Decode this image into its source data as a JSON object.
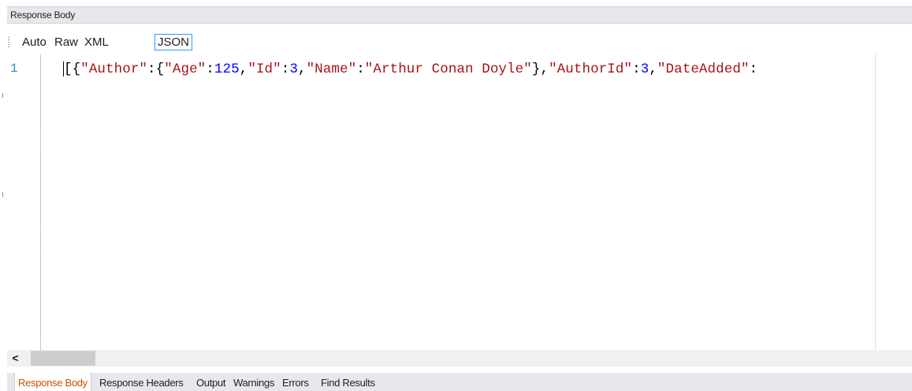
{
  "window": {
    "title": "Response Body"
  },
  "toolbar": {
    "buttons": [
      {
        "label": "Auto",
        "active": false
      },
      {
        "label": "Raw",
        "active": false
      },
      {
        "label": "XML",
        "active": false
      },
      {
        "label": "JSON",
        "active": true
      }
    ]
  },
  "editor": {
    "line_number": "1",
    "tokens": [
      {
        "text": "[{",
        "type": "punct"
      },
      {
        "text": "\"Author\"",
        "type": "key"
      },
      {
        "text": ":{",
        "type": "punct"
      },
      {
        "text": "\"Age\"",
        "type": "key"
      },
      {
        "text": ":",
        "type": "punct"
      },
      {
        "text": "125",
        "type": "num"
      },
      {
        "text": ",",
        "type": "punct"
      },
      {
        "text": "\"Id\"",
        "type": "key"
      },
      {
        "text": ":",
        "type": "punct"
      },
      {
        "text": "3",
        "type": "num"
      },
      {
        "text": ",",
        "type": "punct"
      },
      {
        "text": "\"Name\"",
        "type": "key"
      },
      {
        "text": ":",
        "type": "punct"
      },
      {
        "text": "\"Arthur Conan Doyle\"",
        "type": "str"
      },
      {
        "text": "},",
        "type": "punct"
      },
      {
        "text": "\"AuthorId\"",
        "type": "key"
      },
      {
        "text": ":",
        "type": "punct"
      },
      {
        "text": "3",
        "type": "num"
      },
      {
        "text": ",",
        "type": "punct"
      },
      {
        "text": "\"DateAdded\"",
        "type": "key"
      },
      {
        "text": ":",
        "type": "punct"
      }
    ]
  },
  "scrollbar": {
    "left_arrow": "<"
  },
  "tabs": [
    {
      "label": "Response Body",
      "active": true
    },
    {
      "label": "Response Headers",
      "active": false
    },
    {
      "label": "Output",
      "active": false
    },
    {
      "label": "Warnings",
      "active": false
    },
    {
      "label": "Errors",
      "active": false
    },
    {
      "label": "Find Results",
      "active": false
    }
  ],
  "colors": {
    "accent_tab": "#ca5100",
    "json_string": "#a31515",
    "json_number": "#0000ff",
    "line_number": "#2b91af",
    "active_button_border": "#3399ff"
  }
}
